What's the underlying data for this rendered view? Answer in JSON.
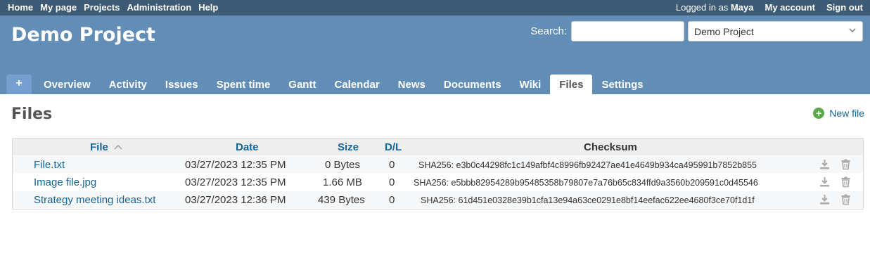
{
  "top_menu": {
    "items": [
      "Home",
      "My page",
      "Projects",
      "Administration",
      "Help"
    ],
    "logged_in_prefix": "Logged in as",
    "user": "Maya",
    "my_account": "My account",
    "sign_out": "Sign out"
  },
  "header": {
    "project_title": "Demo Project",
    "search_label": "Search:",
    "search_value": "",
    "project_jump": "Demo Project"
  },
  "main_menu": {
    "new": "+",
    "tabs": [
      "Overview",
      "Activity",
      "Issues",
      "Spent time",
      "Gantt",
      "Calendar",
      "News",
      "Documents",
      "Wiki",
      "Files",
      "Settings"
    ],
    "selected": "Files"
  },
  "content": {
    "title": "Files",
    "new_file": "New file"
  },
  "table": {
    "headers": {
      "file": "File",
      "date": "Date",
      "size": "Size",
      "dl": "D/L",
      "checksum": "Checksum"
    },
    "rows": [
      {
        "file": "File.txt",
        "date": "03/27/2023 12:35 PM",
        "size": "0 Bytes",
        "dl": "0",
        "checksum": "SHA256: e3b0c44298fc1c149afbf4c8996fb92427ae41e4649b934ca495991b7852b855"
      },
      {
        "file": "Image file.jpg",
        "date": "03/27/2023 12:35 PM",
        "size": "1.66 MB",
        "dl": "0",
        "checksum": "SHA256: e5bbb82954289b95485358b79807e7a76b65c834ffd9a3560b209591c0d45546"
      },
      {
        "file": "Strategy meeting ideas.txt",
        "date": "03/27/2023 12:36 PM",
        "size": "439 Bytes",
        "dl": "0",
        "checksum": "SHA256: 61d451e0328e39b1cfa13e94a63ce0291e8bf14eefac622ee4680f3ce70f1d1f"
      }
    ]
  },
  "colors": {
    "top_menu": "#3e5b76",
    "header": "#628db6",
    "link": "#116699",
    "new_icon": "#5aaa4a"
  }
}
